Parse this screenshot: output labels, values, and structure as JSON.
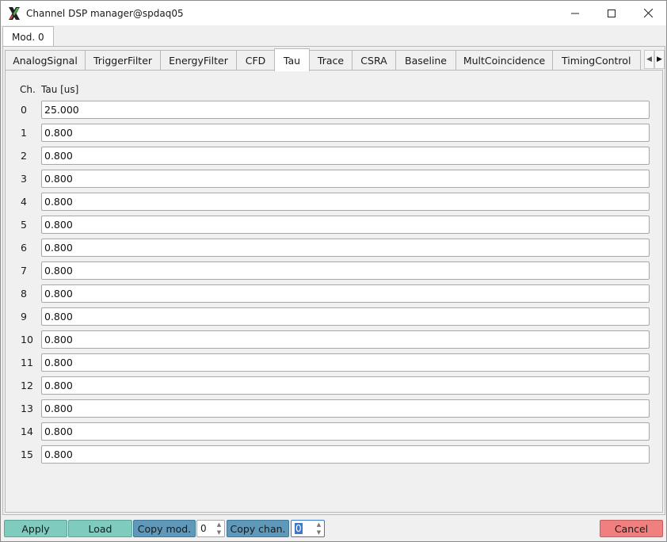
{
  "window": {
    "title": "Channel DSP manager@spdaq05",
    "minimize_icon": "minimize-icon",
    "maximize_icon": "maximize-icon",
    "close_icon": "close-icon"
  },
  "module_tab": {
    "label": "Mod. 0"
  },
  "tabs": [
    {
      "label": "AnalogSignal"
    },
    {
      "label": "TriggerFilter"
    },
    {
      "label": "EnergyFilter"
    },
    {
      "label": "CFD"
    },
    {
      "label": "Tau",
      "active": true
    },
    {
      "label": "Trace"
    },
    {
      "label": "CSRA"
    },
    {
      "label": "Baseline"
    },
    {
      "label": "MultCoincidence"
    },
    {
      "label": "TimingControl"
    }
  ],
  "table": {
    "header_ch": "Ch.",
    "header_value": "Tau [us]",
    "rows": [
      {
        "ch": "0",
        "value": "25.000"
      },
      {
        "ch": "1",
        "value": "0.800"
      },
      {
        "ch": "2",
        "value": "0.800"
      },
      {
        "ch": "3",
        "value": "0.800"
      },
      {
        "ch": "4",
        "value": "0.800"
      },
      {
        "ch": "5",
        "value": "0.800"
      },
      {
        "ch": "6",
        "value": "0.800"
      },
      {
        "ch": "7",
        "value": "0.800"
      },
      {
        "ch": "8",
        "value": "0.800"
      },
      {
        "ch": "9",
        "value": "0.800"
      },
      {
        "ch": "10",
        "value": "0.800"
      },
      {
        "ch": "11",
        "value": "0.800"
      },
      {
        "ch": "12",
        "value": "0.800"
      },
      {
        "ch": "13",
        "value": "0.800"
      },
      {
        "ch": "14",
        "value": "0.800"
      },
      {
        "ch": "15",
        "value": "0.800"
      }
    ]
  },
  "bottom": {
    "apply": "Apply",
    "load": "Load",
    "copy_mod": "Copy mod.",
    "copy_mod_value": "0",
    "copy_chan": "Copy chan.",
    "copy_chan_value": "0",
    "cancel": "Cancel"
  },
  "colors": {
    "button_teal": "#7fcbbe",
    "button_blue": "#5f98b8",
    "button_red": "#f08080"
  }
}
